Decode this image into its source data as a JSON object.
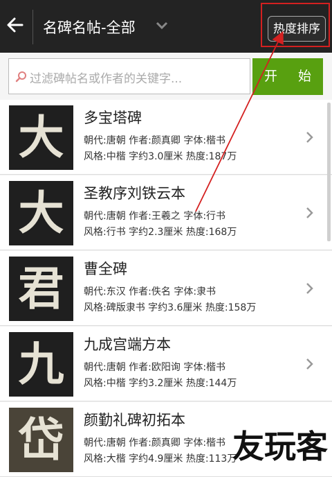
{
  "header": {
    "title": "名碑名帖-全部",
    "sort_label": "热度排序"
  },
  "search": {
    "placeholder": "过滤碑帖名或作者的关键字...",
    "start_label": "开 始"
  },
  "list": {
    "items": [
      {
        "title": "多宝塔碑",
        "glyph": "大",
        "line1": "朝代:唐朝  作者:颜真卿  字体:楷书",
        "line2": "风格:中楷  字约3.0厘米  热度:187万"
      },
      {
        "title": "圣教序刘铁云本",
        "glyph": "大",
        "line1": "朝代:唐朝  作者:王羲之  字体:行书",
        "line2": "风格:行书  字约2.3厘米  热度:168万"
      },
      {
        "title": "曹全碑",
        "glyph": "君",
        "line1": "朝代:东汉  作者:佚名  字体:隶书",
        "line2": "风格:碑版隶书  字约3.6厘米  热度:158万"
      },
      {
        "title": "九成宫端方本",
        "glyph": "九",
        "line1": "朝代:唐朝  作者:欧阳询  字体:楷书",
        "line2": "风格:中楷  字约3.2厘米  热度:144万"
      },
      {
        "title": "颜勤礼碑初拓本",
        "glyph": "岱",
        "line1": "朝代:唐朝  作者:颜真卿  字体:楷书",
        "line2": "风格:大楷  字约4.9厘米  热度:113万"
      }
    ]
  },
  "watermark": "友玩客",
  "colors": {
    "topbar": "#232323",
    "start_button": "#58a010",
    "annotation": "#d42020"
  }
}
